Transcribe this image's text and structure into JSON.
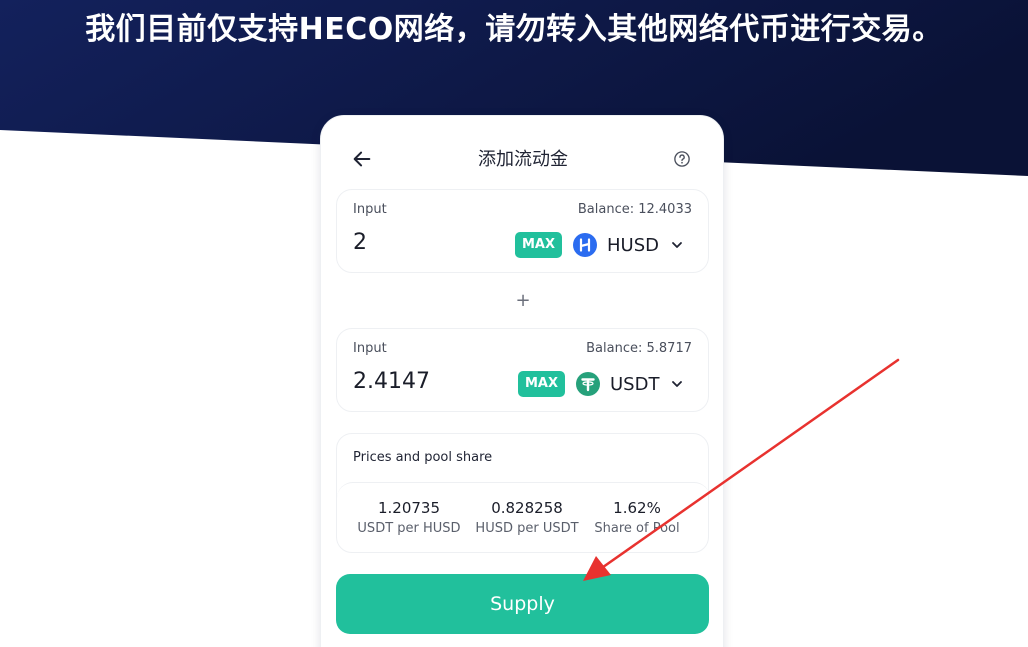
{
  "banner": {
    "text": "我们目前仅支持HECO网络，请勿转入其他网络代币进行交易。"
  },
  "colors": {
    "banner_bg": "#0e1a4a",
    "accent": "#21c09c",
    "annotation_arrow": "#e8322f"
  },
  "card": {
    "title": "添加流动金",
    "back_icon": "arrow-left-icon",
    "help_icon": "question-circle-icon"
  },
  "input_a": {
    "label": "Input",
    "balance": "Balance: 12.4033",
    "value": "2",
    "max_label": "MAX",
    "token": "HUSD",
    "token_icon": "husd-token-icon"
  },
  "plus": "+",
  "input_b": {
    "label": "Input",
    "balance": "Balance: 5.8717",
    "value": "2.4147",
    "max_label": "MAX",
    "token": "USDT",
    "token_icon": "usdt-token-icon"
  },
  "pool": {
    "title": "Prices and pool share",
    "stats": [
      {
        "value": "1.20735",
        "label": "USDT per HUSD"
      },
      {
        "value": "0.828258",
        "label": "HUSD per USDT"
      },
      {
        "value": "1.62%",
        "label": "Share of Pool"
      }
    ]
  },
  "supply": {
    "label": "Supply"
  }
}
